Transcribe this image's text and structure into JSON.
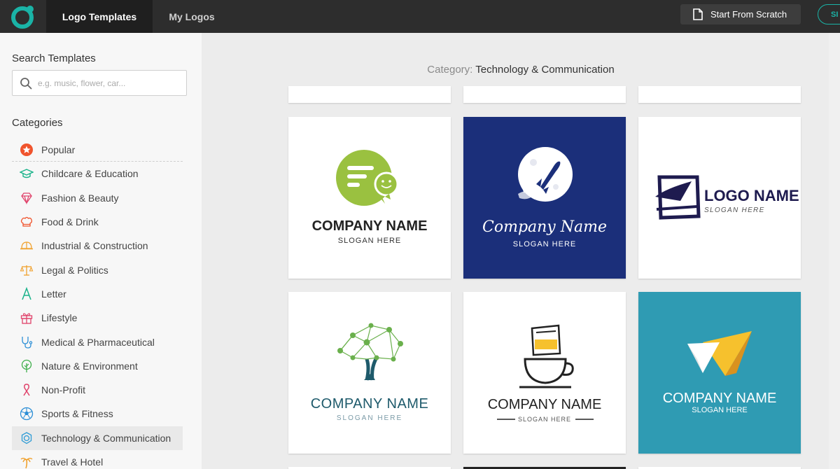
{
  "topbar": {
    "tabs": [
      {
        "label": "Logo Templates",
        "active": true
      },
      {
        "label": "My Logos",
        "active": false
      }
    ],
    "scratch_label": "Start From Scratch",
    "signin_label": "SI"
  },
  "sidebar": {
    "search_title": "Search Templates",
    "search_placeholder": "e.g. music, flower, car...",
    "categories_title": "Categories",
    "categories": [
      {
        "label": "Popular",
        "icon": "star-icon"
      },
      {
        "label": "Childcare & Education",
        "icon": "graduation-cap-icon"
      },
      {
        "label": "Fashion & Beauty",
        "icon": "diamond-icon"
      },
      {
        "label": "Food & Drink",
        "icon": "chef-hat-icon"
      },
      {
        "label": "Industrial & Construction",
        "icon": "hard-hat-icon"
      },
      {
        "label": "Legal & Politics",
        "icon": "scales-icon"
      },
      {
        "label": "Letter",
        "icon": "letter-a-icon"
      },
      {
        "label": "Lifestyle",
        "icon": "gift-icon"
      },
      {
        "label": "Medical & Pharmaceutical",
        "icon": "stethoscope-icon"
      },
      {
        "label": "Nature & Environment",
        "icon": "tree-icon"
      },
      {
        "label": "Non-Profit",
        "icon": "ribbon-icon"
      },
      {
        "label": "Sports & Fitness",
        "icon": "soccer-ball-icon"
      },
      {
        "label": "Technology & Communication",
        "icon": "gear-network-icon",
        "selected": true
      },
      {
        "label": "Travel & Hotel",
        "icon": "palm-tree-icon"
      }
    ]
  },
  "main": {
    "category_prefix": "Category:",
    "category_name": "Technology & Communication",
    "cards": [
      {
        "company": "COMPANY NAME",
        "slogan": "SLOGAN HERE"
      },
      {
        "company": "Company Name",
        "slogan": "SLOGAN HERE"
      },
      {
        "company": "LOGO NAME",
        "slogan": "SLOGAN HERE"
      },
      {
        "company": "COMPANY NAME",
        "slogan": "SLOGAN HERE"
      },
      {
        "company": "COMPANY NAME",
        "slogan": "SLOGAN HERE"
      },
      {
        "company": "COMPANY NAME",
        "slogan": "SLOGAN HERE"
      }
    ]
  },
  "colors": {
    "brand_teal": "#1ab3a6",
    "topbar": "#2d2d2d",
    "card_navy": "#1b2f7a",
    "card_teal": "#2f9bb3",
    "chat_green": "#9ac140"
  }
}
